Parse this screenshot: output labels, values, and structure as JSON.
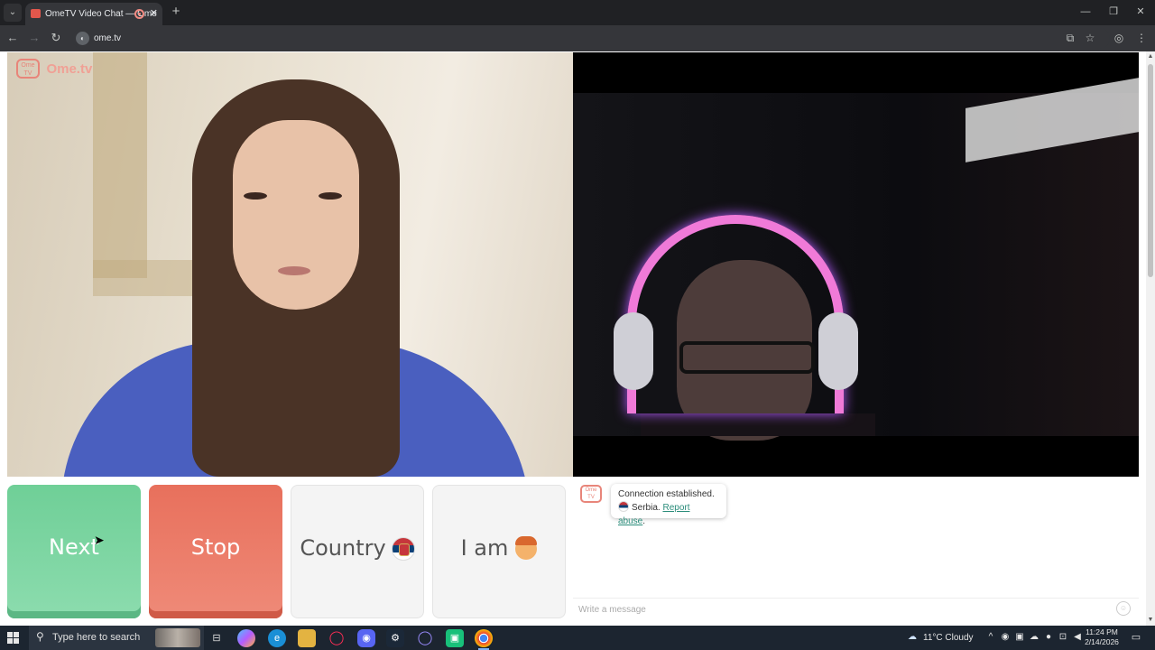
{
  "browser": {
    "tab_title": "OmeTV Video Chat — Ome",
    "url": "ome.tv"
  },
  "site": {
    "logo_text": "Ome.tv",
    "logo_badge": "Ome TV"
  },
  "controls": {
    "next_label": "Next",
    "stop_label": "Stop",
    "country_label": "Country",
    "iam_label": "I am"
  },
  "chat": {
    "status_message": "Connection established.",
    "country_name": "Serbia.",
    "report_label": "Report abuse",
    "report_suffix": ".",
    "input_placeholder": "Write a message"
  },
  "taskbar": {
    "search_placeholder": "Type here to search",
    "weather": "11°C  Cloudy",
    "time": "11:24 PM",
    "date": "2/14/2026"
  },
  "icons": {
    "flag": "serbia-flag",
    "iam_emoji": "boy-emoji"
  },
  "colors": {
    "next": "#6fcf97",
    "stop": "#e8705c",
    "link": "#2a8c7a"
  }
}
